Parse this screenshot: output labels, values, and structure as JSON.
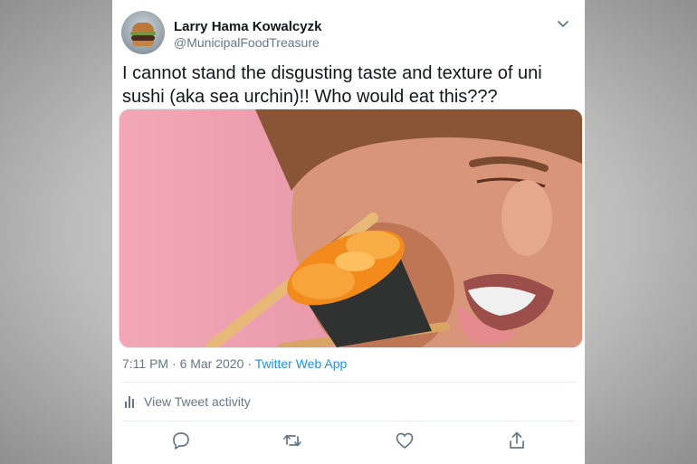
{
  "tweet": {
    "author_name": "Larry Hama Kowalcyzk",
    "author_handle": "@MunicipalFoodTreasure",
    "text": "I cannot stand the disgusting taste and texture of uni sushi (aka sea urchin)!! Who would eat this???",
    "time": "7:11 PM",
    "separator": "·",
    "date": "6 Mar 2020",
    "source": "Twitter Web App",
    "activity_label": "View Tweet activity"
  },
  "icons": {
    "avatar": "burger-avatar",
    "menu": "chevron-down-icon",
    "activity": "bar-chart-icon",
    "actions": [
      "reply-icon",
      "retweet-icon",
      "like-icon",
      "share-icon"
    ]
  },
  "colors": {
    "link": "#1b95e0",
    "secondary_text": "#657786",
    "primary_text": "#14171a"
  }
}
